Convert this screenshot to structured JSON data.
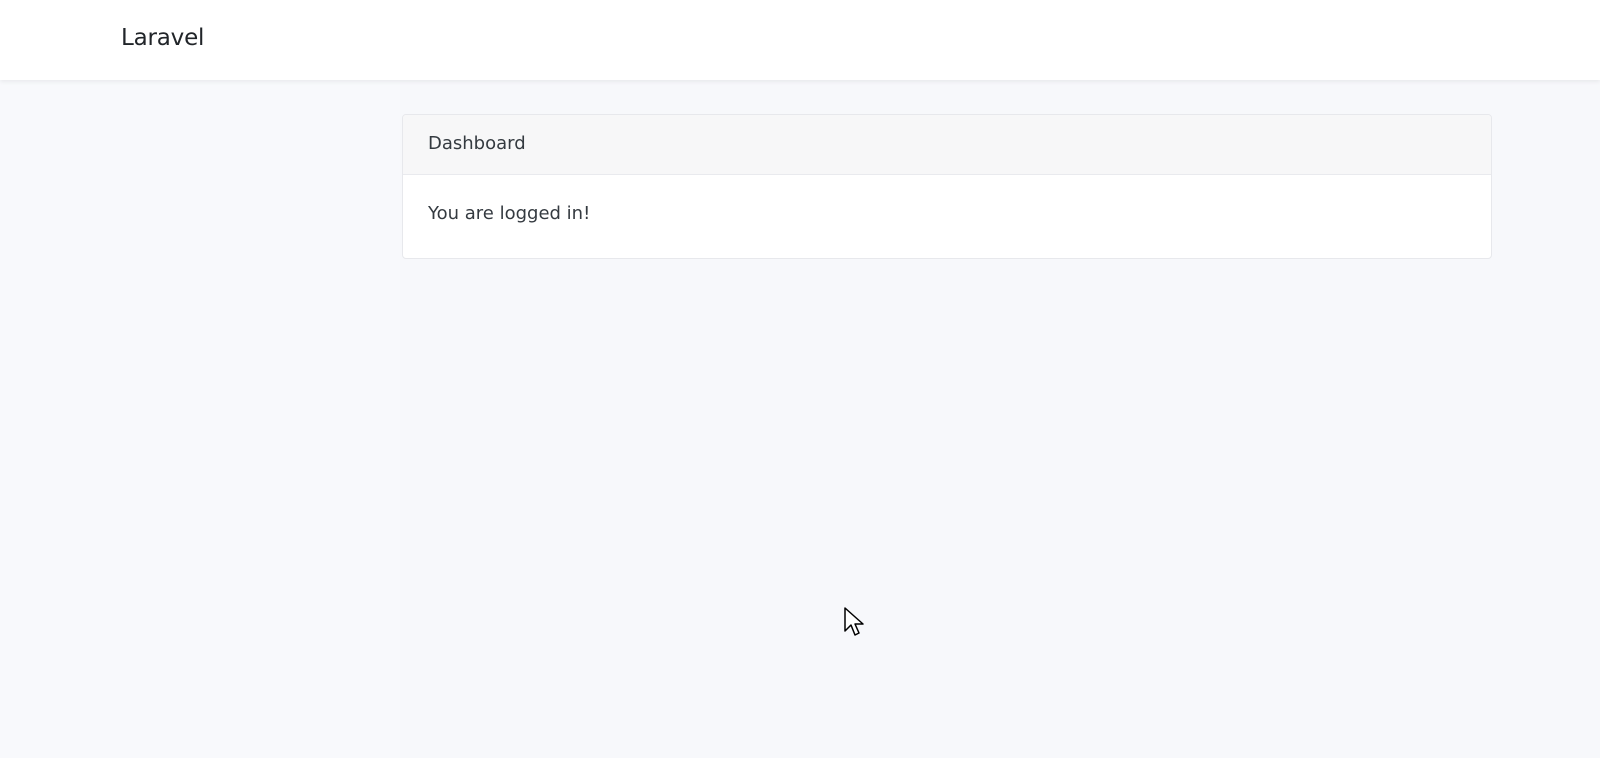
{
  "navbar": {
    "brand": "Laravel"
  },
  "card": {
    "header": "Dashboard",
    "body": "You are logged in!"
  },
  "cursor": {
    "icon": "arrow-cursor-icon"
  }
}
